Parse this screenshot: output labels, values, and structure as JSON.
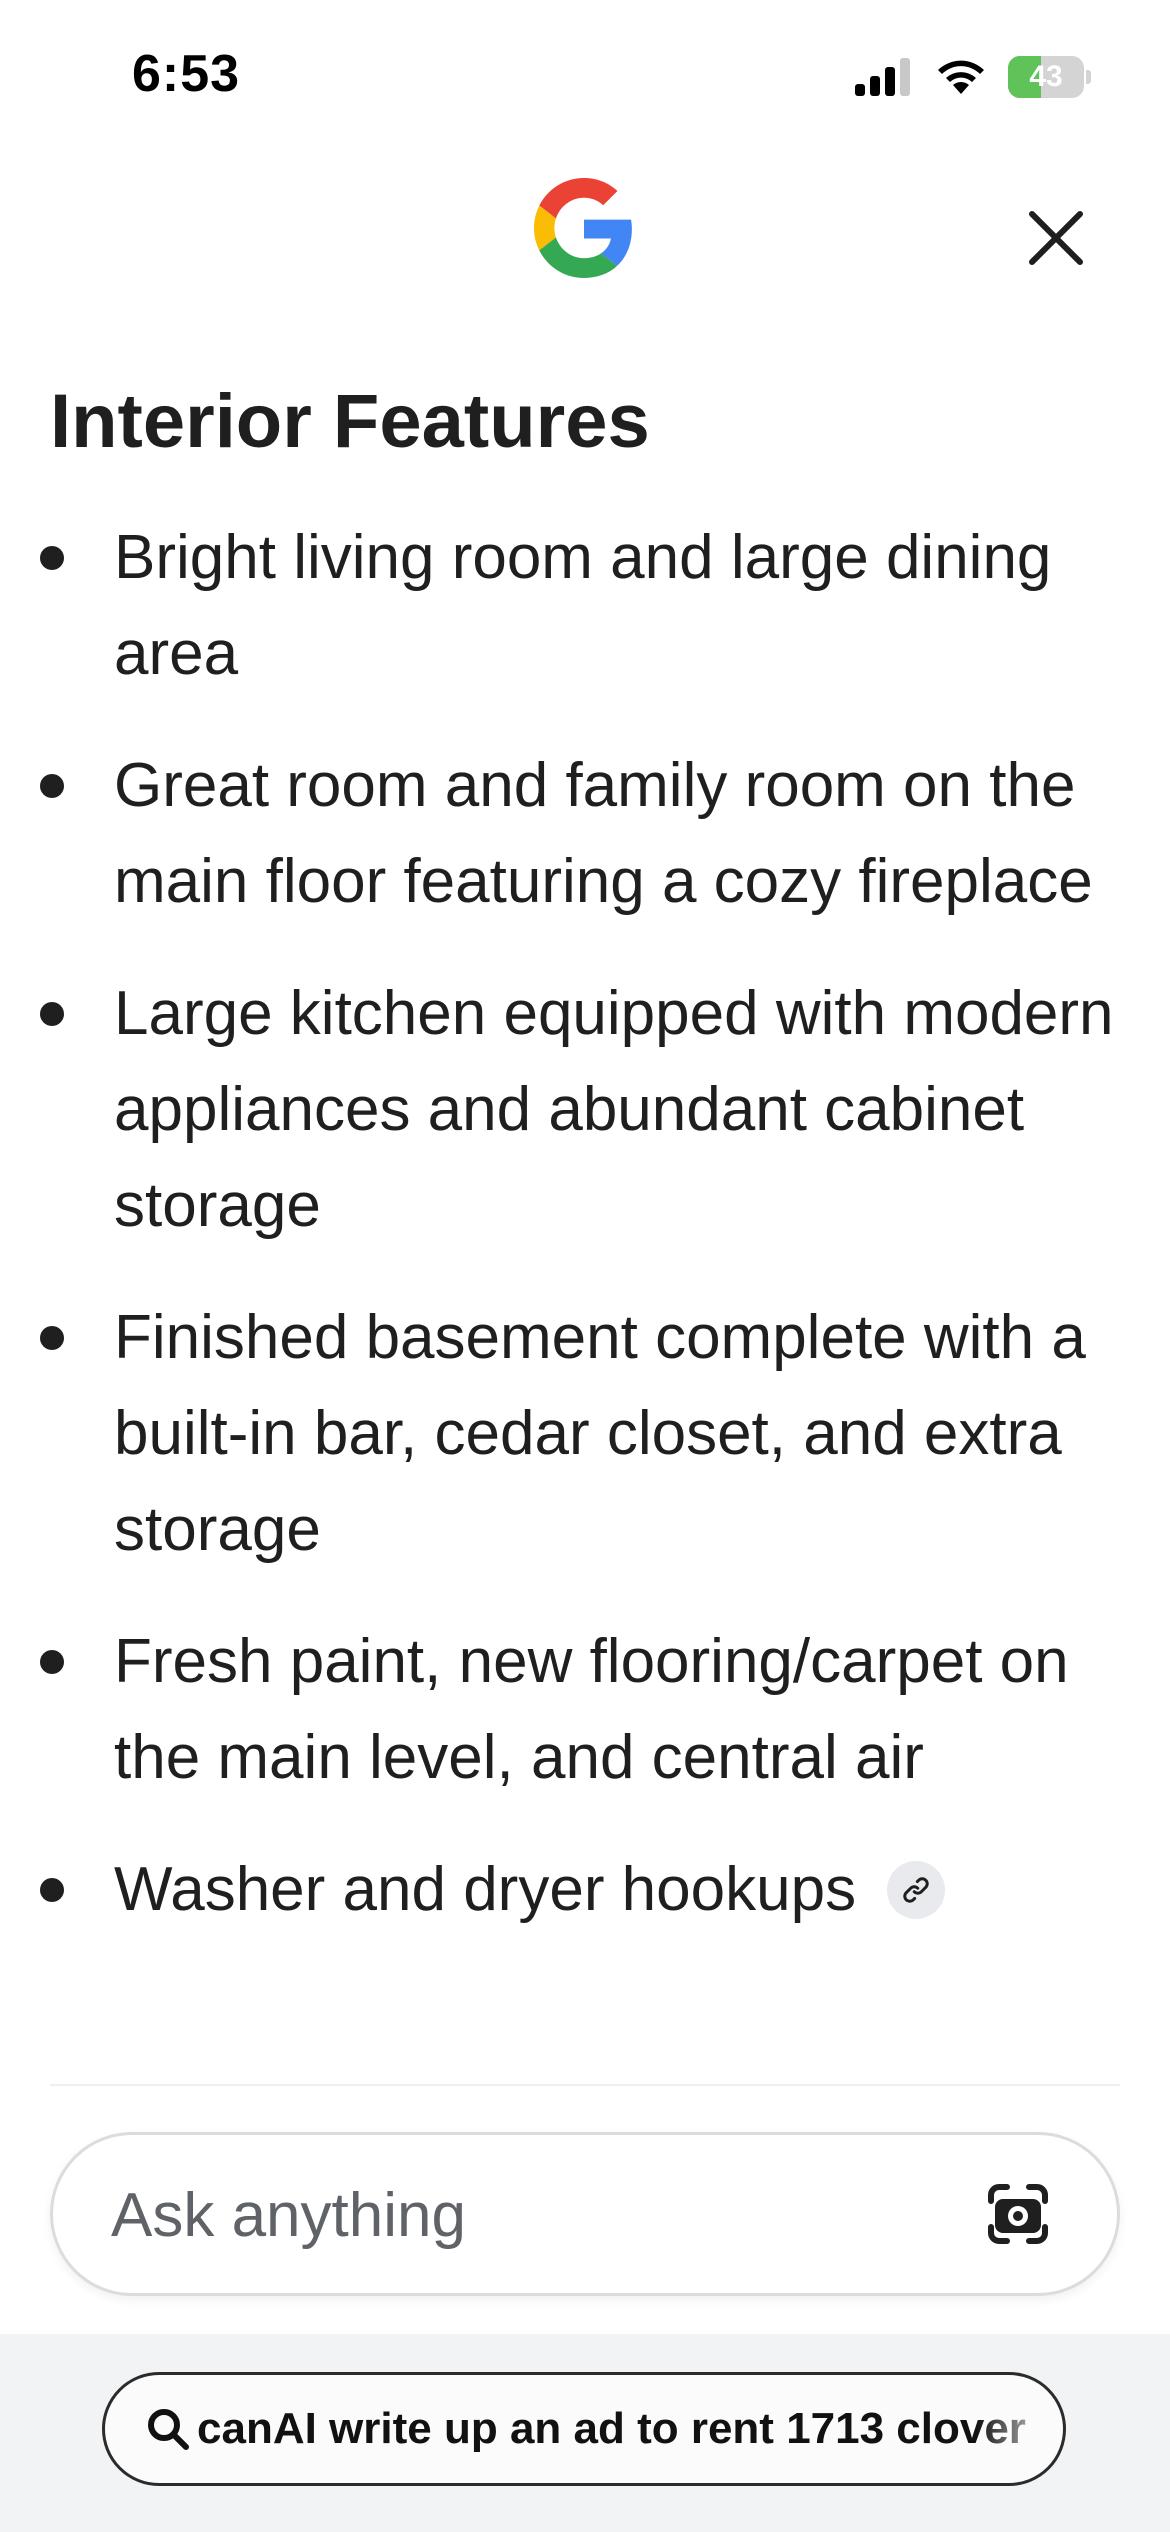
{
  "status_bar": {
    "time": "6:53",
    "battery_level": "43",
    "battery_fraction": 0.43,
    "signal_icon": "cellular-signal-icon",
    "wifi_icon": "wifi-icon",
    "battery_icon": "battery-charging-icon"
  },
  "header": {
    "logo_icon": "google-g-logo",
    "close_icon": "close-icon"
  },
  "section": {
    "title": "Interior Features",
    "items": [
      {
        "text": "Bright living room and large dining area"
      },
      {
        "text": "Great room and family room on the main floor featuring a cozy fireplace"
      },
      {
        "text": "Large kitchen equipped with modern appliances and abundant cabinet storage"
      },
      {
        "text": "Finished basement complete with a built-in bar, cedar closet, and extra storage"
      },
      {
        "text": "Fresh paint, new flooring/carpet on the main level, and central air"
      },
      {
        "text": "Washer and dryer hookups",
        "link_icon": "link-icon"
      }
    ]
  },
  "ask_bar": {
    "placeholder": "Ask anything",
    "lens_icon": "google-lens-icon"
  },
  "bottom": {
    "query": "canAI write up an ad to rent 1713 clover",
    "search_icon": "search-icon"
  },
  "colors": {
    "text": "#1f1f1f",
    "battery": "#5fc35a",
    "bottom_background": "#f2f3f4"
  }
}
